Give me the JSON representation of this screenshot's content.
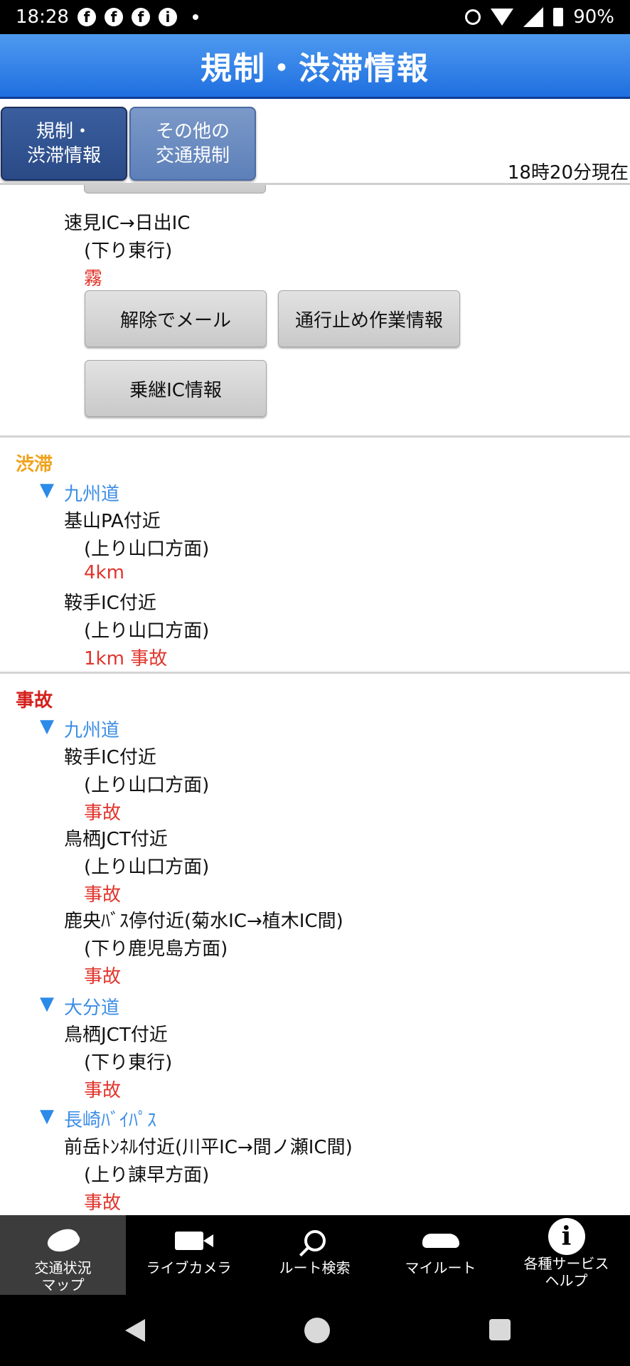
{
  "status_bar": {
    "time": "18:28",
    "battery": "90%",
    "icons": [
      "facebook-icon",
      "facebook-icon",
      "facebook-icon",
      "info-icon"
    ]
  },
  "header": {
    "title": "規制・渋滞情報"
  },
  "tabs": [
    {
      "label_line1": "規制・",
      "label_line2": "渋滞情報",
      "active": true
    },
    {
      "label_line1": "その他の",
      "label_line2": "交通規制",
      "active": false
    }
  ],
  "timestamp": "18時20分現在",
  "regulation": {
    "location": "速見IC→日出IC",
    "direction": "(下り東行)",
    "reason": "霧",
    "buttons": {
      "mail": "解除でメール",
      "closure": "通行止め作業情報",
      "transfer": "乗継IC情報"
    }
  },
  "congestion": {
    "heading": "渋滞",
    "route": "九州道",
    "items": [
      {
        "location": "基山PA付近",
        "direction": "(上り山口方面)",
        "detail": "4km"
      },
      {
        "location": "鞍手IC付近",
        "direction": "(上り山口方面)",
        "detail": "1km 事故"
      }
    ]
  },
  "accidents": {
    "heading": "事故",
    "routes": [
      {
        "name": "九州道",
        "items": [
          {
            "location": "鞍手IC付近",
            "direction": "(上り山口方面)",
            "detail": "事故"
          },
          {
            "location": "鳥栖JCT付近",
            "direction": "(上り山口方面)",
            "detail": "事故"
          },
          {
            "location": "鹿央ﾊﾞｽ停付近(菊水IC→植木IC間)",
            "direction": "(下り鹿児島方面)",
            "detail": "事故"
          }
        ]
      },
      {
        "name": "大分道",
        "items": [
          {
            "location": "鳥栖JCT付近",
            "direction": "(下り東行)",
            "detail": "事故"
          }
        ]
      },
      {
        "name": "長崎ﾊﾞｲﾊﾟｽ",
        "items": [
          {
            "location": "前岳ﾄﾝﾈﾙ付近(川平IC→間ノ瀬IC間)",
            "direction": "(上り諌早方面)",
            "detail": "事故"
          }
        ]
      }
    ]
  },
  "bottom_nav": [
    {
      "line1": "交通状況",
      "line2": "マップ",
      "icon": "japan-map-icon",
      "active": true
    },
    {
      "line1": "ライブカメラ",
      "line2": "",
      "icon": "video-camera-icon",
      "active": false
    },
    {
      "line1": "ルート検索",
      "line2": "",
      "icon": "search-icon",
      "active": false
    },
    {
      "line1": "マイルート",
      "line2": "",
      "icon": "car-icon",
      "active": false
    },
    {
      "line1": "各種サービス",
      "line2": "ヘルプ",
      "icon": "info-icon",
      "active": false
    }
  ],
  "colors": {
    "header": "#2a7de6",
    "active_tab": "#2f4f8f",
    "accent_red": "#e0342c",
    "congestion_orange": "#f0a21a",
    "route_blue": "#2c8ae8"
  }
}
